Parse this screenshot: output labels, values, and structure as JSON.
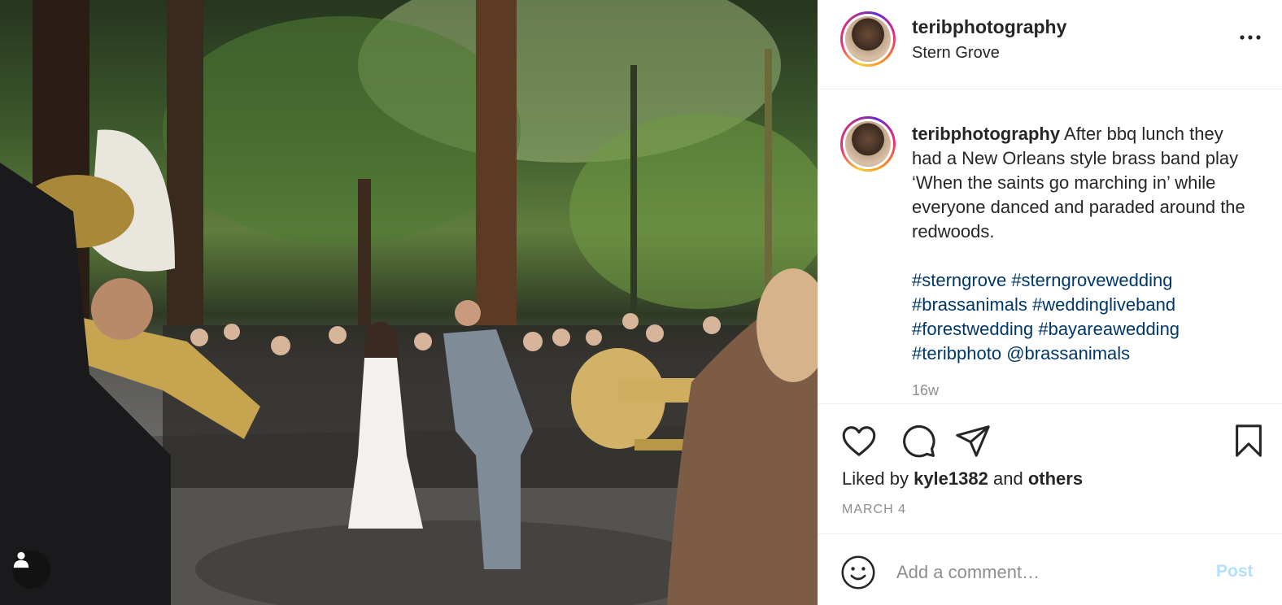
{
  "post": {
    "username": "teribphotography",
    "location": "Stern Grove",
    "caption_username": "teribphotography",
    "caption_text": "After bbq lunch they had a New Orleans style brass band play ‘When the saints go marching in’ while everyone danced and paraded around the redwoods.",
    "hashtags": [
      "#sterngrove",
      "#sterngrovewedding",
      "#brassanimals",
      "#weddingliveband",
      "#forestwedding",
      "#bayareawedding",
      "#teribphoto",
      "@brassanimals"
    ],
    "age": "16w",
    "liked_by_prefix": "Liked by",
    "liked_by_user": "kyle1382",
    "liked_by_and": "and",
    "liked_by_others": "others",
    "date": "MARCH 4"
  },
  "icons": {
    "more": "more-horizontal-icon",
    "like": "heart-icon",
    "comment": "comment-icon",
    "share": "share-icon",
    "save": "bookmark-icon",
    "emoji": "smiley-icon",
    "user": "user-icon"
  },
  "comment": {
    "placeholder": "Add a comment…",
    "post_label": "Post"
  },
  "colors": {
    "link": "#00376b",
    "muted": "#8e8e8e",
    "post_disabled": "#b2dffc",
    "border": "#efefef"
  }
}
